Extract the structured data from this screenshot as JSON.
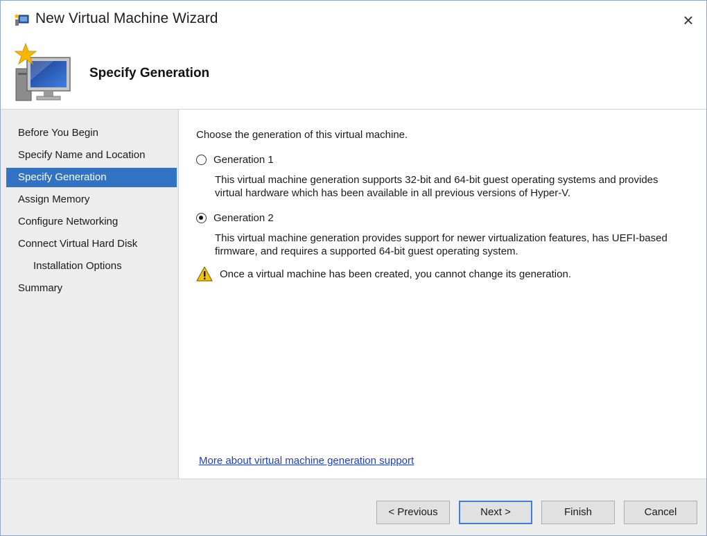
{
  "window": {
    "title": "New Virtual Machine Wizard",
    "close_glyph": "×"
  },
  "header": {
    "title": "Specify Generation",
    "icon": "new-vm-monitor-icon"
  },
  "sidebar": {
    "items": [
      {
        "label": "Before You Begin",
        "active": false,
        "sub": false
      },
      {
        "label": "Specify Name and Location",
        "active": false,
        "sub": false
      },
      {
        "label": "Specify Generation",
        "active": true,
        "sub": false
      },
      {
        "label": "Assign Memory",
        "active": false,
        "sub": false
      },
      {
        "label": "Configure Networking",
        "active": false,
        "sub": false
      },
      {
        "label": "Connect Virtual Hard Disk",
        "active": false,
        "sub": false
      },
      {
        "label": "Installation Options",
        "active": false,
        "sub": true
      },
      {
        "label": "Summary",
        "active": false,
        "sub": false
      }
    ]
  },
  "main": {
    "intro": "Choose the generation of this virtual machine.",
    "options": [
      {
        "label": "Generation 1",
        "checked": false,
        "description_line1": "This virtual machine generation supports 32-bit and 64-bit guest operating systems and provides",
        "description_line2": "virtual hardware which has been available in all previous versions of Hyper-V."
      },
      {
        "label": "Generation 2",
        "checked": true,
        "description_line1": "This virtual machine generation provides support for newer virtualization features, has UEFI-based",
        "description_line2": "firmware, and requires a supported 64-bit guest operating system."
      }
    ],
    "warning": "Once a virtual machine has been created, you cannot change its generation.",
    "more_link": "More about virtual machine generation support"
  },
  "footer": {
    "previous": "< Previous",
    "next": "Next >",
    "finish": "Finish",
    "cancel": "Cancel"
  },
  "colors": {
    "accent": "#3373c4",
    "link": "#1f3fbf",
    "panel": "#ededed"
  }
}
